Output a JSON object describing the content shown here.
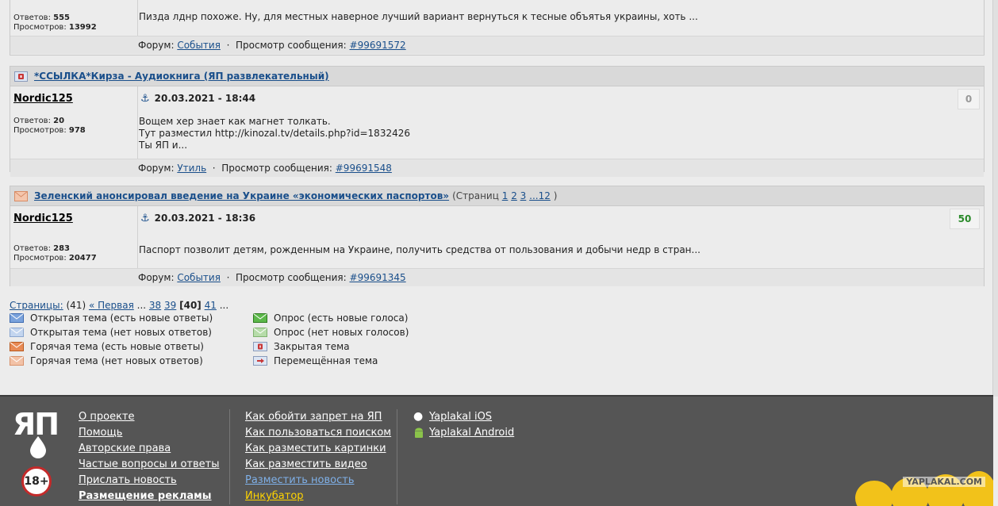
{
  "posts": [
    {
      "stats_replies_label": "Ответов:",
      "stats_replies": "555",
      "stats_views_label": "Просмотров:",
      "stats_views": "13992",
      "body": [
        "Пизда лднр похоже. Ну, для местных наверное лучший вариант вернуться к тесные объятья украины, хоть ..."
      ],
      "forum_label": "Форум:",
      "forum": "События",
      "view_label": "Просмотр сообщения:",
      "msg_link": "#99691572"
    },
    {
      "title": "*ССЫЛКА*Кирза - Аудиокнига (ЯП развлекательный)",
      "icon": "locked-topic-icon",
      "user": "Nordic125",
      "date": "20.03.2021 - 18:44",
      "rating": "0",
      "rating_color": "#999999",
      "stats_replies_label": "Ответов:",
      "stats_replies": "20",
      "stats_views_label": "Просмотров:",
      "stats_views": "978",
      "body": [
        "Вощем хер знает как магнет толкать.",
        "Тут разместил http://kinozal.tv/details.php?id=1832426",
        "Ты ЯП и..."
      ],
      "forum_label": "Форум:",
      "forum": "Утиль",
      "view_label": "Просмотр сообщения:",
      "msg_link": "#99691548"
    },
    {
      "title": "Зеленский анонсировал введение на Украине «экономических паспортов»",
      "pages_prefix": "(Страниц",
      "pages": [
        "1",
        "2",
        "3",
        "...12"
      ],
      "pages_suffix": ")",
      "icon": "hot-topic-icon",
      "user": "Nordic125",
      "date": "20.03.2021 - 18:36",
      "rating": "50",
      "rating_color": "#2a8a2a",
      "stats_replies_label": "Ответов:",
      "stats_replies": "283",
      "stats_views_label": "Просмотров:",
      "stats_views": "20477",
      "body": [
        "Паспорт позволит детям, рожденным на Украине, получить средства от пользования и добычи недр в стран..."
      ],
      "forum_label": "Форум:",
      "forum": "События",
      "view_label": "Просмотр сообщения:",
      "msg_link": "#99691345"
    }
  ],
  "pagination": {
    "label": "Страницы:",
    "total": "(41)",
    "first": "« Первая",
    "ellipsis": "...",
    "p38": "38",
    "p39": "39",
    "current": "[40]",
    "p41": "41",
    "trail": "..."
  },
  "legend": [
    {
      "label": "Открытая тема (есть новые ответы)",
      "icon": "open-new-icon",
      "color": "#5a86c8"
    },
    {
      "label": "Открытая тема (нет новых ответов)",
      "icon": "open-nonew-icon",
      "color": "#a9c2e6"
    },
    {
      "label": "Горячая тема (есть новые ответы)",
      "icon": "hot-new-icon",
      "color": "#e0763a"
    },
    {
      "label": "Горячая тема (нет новых ответов)",
      "icon": "hot-nonew-icon",
      "color": "#eab396"
    },
    {
      "label": "Опрос (есть новые голоса)",
      "icon": "poll-new-icon",
      "color": "#4aa838"
    },
    {
      "label": "Опрос (нет новых голосов)",
      "icon": "poll-nonew-icon",
      "color": "#a5d39a"
    },
    {
      "label": "Закрытая тема",
      "icon": "locked-topic-icon",
      "color": "#c83838"
    },
    {
      "label": "Перемещённая тема",
      "icon": "moved-topic-icon",
      "color": "#c83838"
    }
  ],
  "footer": {
    "logo_text": "ЯП",
    "age_badge": "18+",
    "col1": [
      "О проекте",
      "Помощь",
      "Авторские права",
      "Частые вопросы и ответы",
      "Прислать новость",
      "Размещение рекламы"
    ],
    "col2": [
      "Как обойти запрет на ЯП",
      "Как пользоваться поиском",
      "Как разместить картинки",
      "Как разместить видео",
      "Разместить новость",
      "Инкубатор"
    ],
    "col3": [
      "Yaplakal iOS",
      "Yaplakal Android"
    ],
    "corner_text": "YAPLAKAL.COM",
    "accent_news": "#7fb0e8",
    "accent_incubator": "#ffd400"
  }
}
